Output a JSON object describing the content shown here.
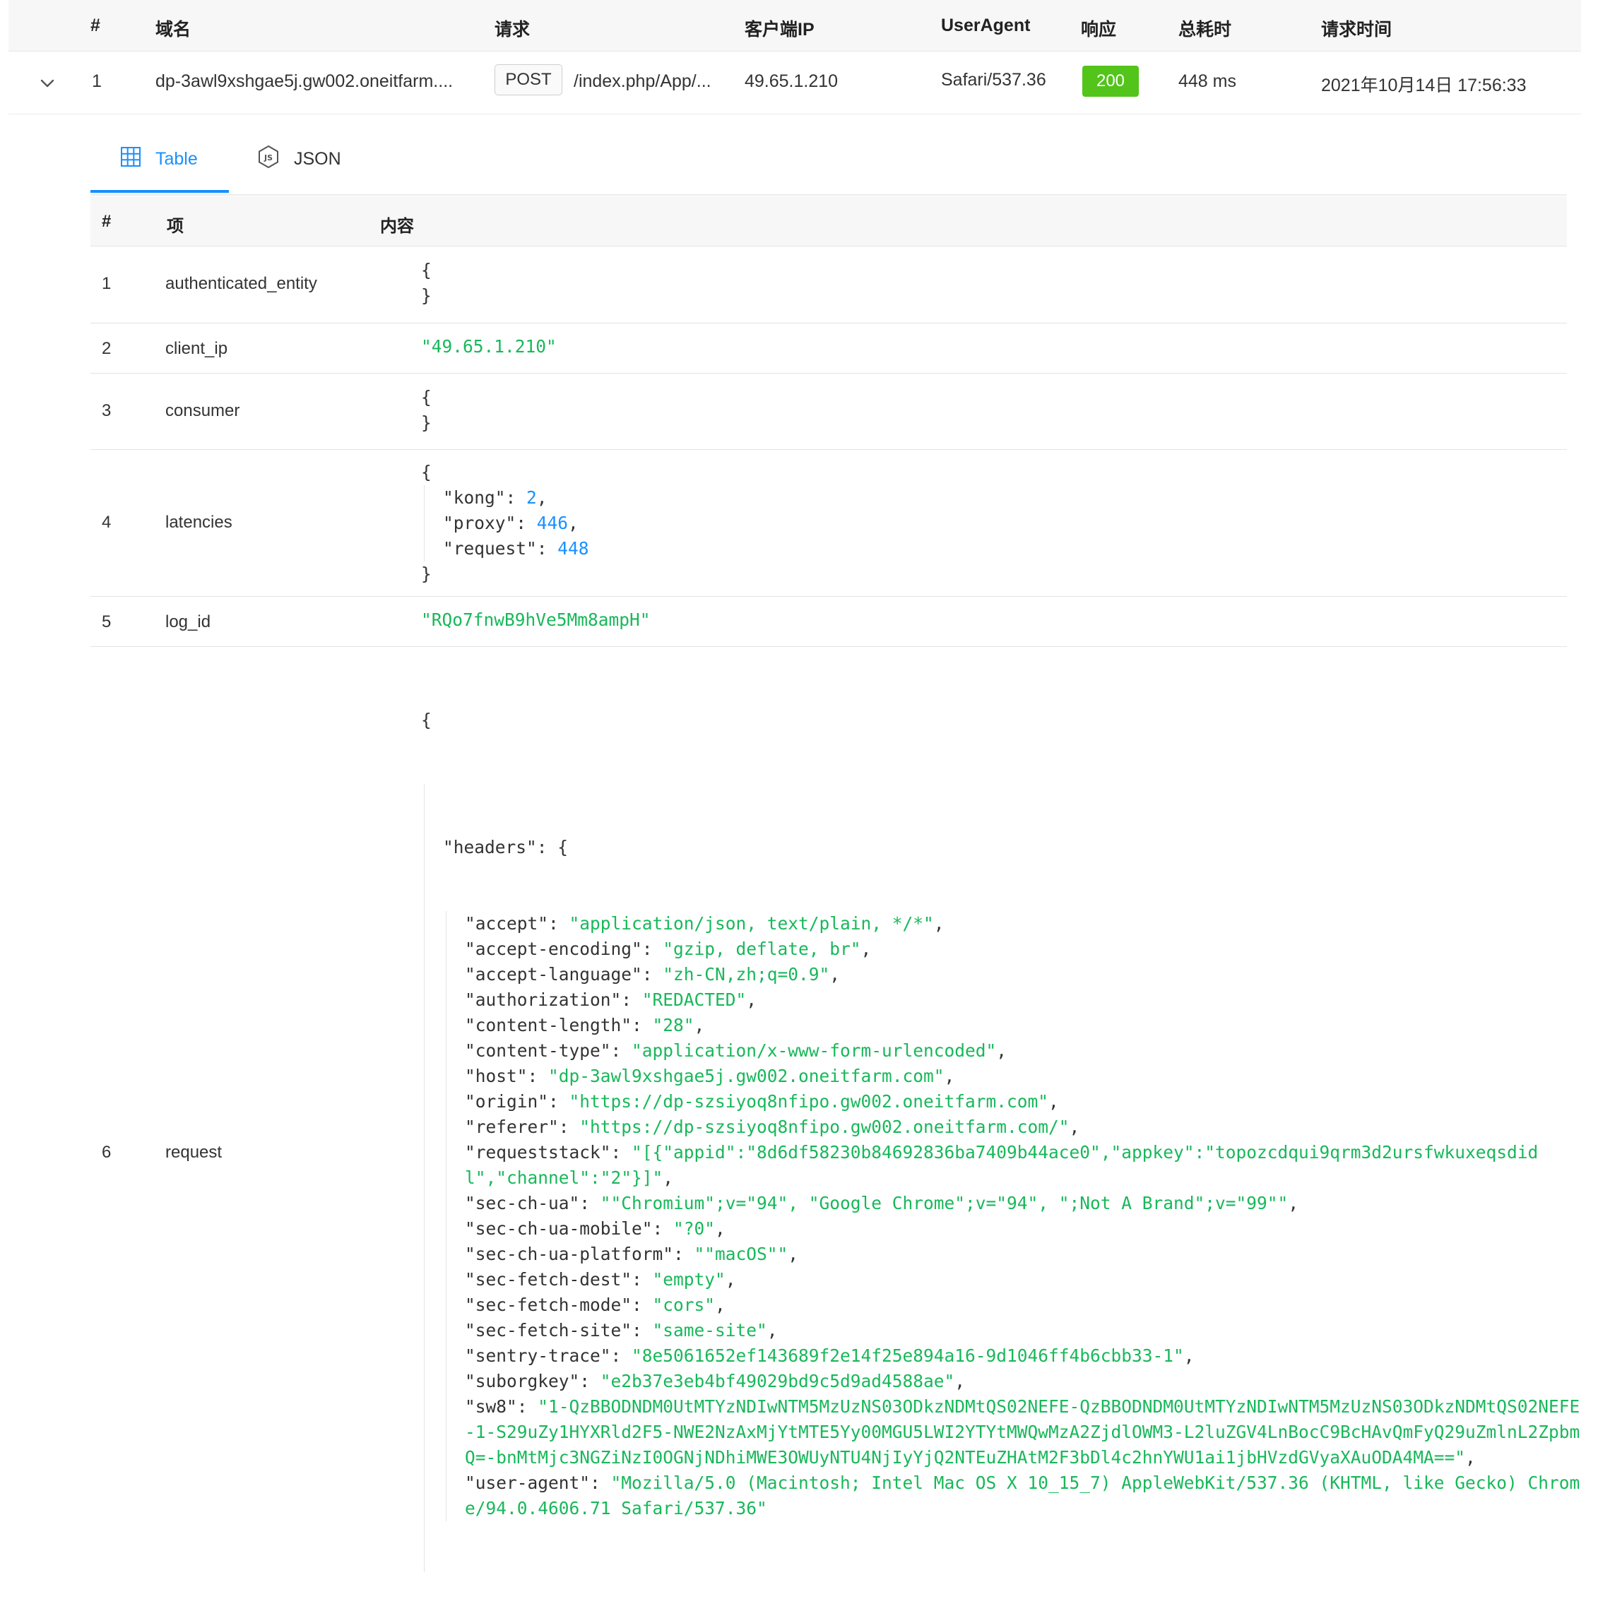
{
  "main_table": {
    "headers": [
      "#",
      "域名",
      "请求",
      "客户端IP",
      "UserAgent",
      "响应",
      "总耗时",
      "请求时间"
    ],
    "row": {
      "index": "1",
      "domain": "dp-3awl9xshgae5j.gw002.oneitfarm....",
      "method": "POST",
      "path": "/index.php/App/...",
      "client_ip": "49.65.1.210",
      "user_agent": "Safari/537.36",
      "status": "200",
      "duration": "448 ms",
      "time": "2021年10月14日 17:56:33"
    }
  },
  "tabs": {
    "table": "Table",
    "json": "JSON",
    "active": "table"
  },
  "detail_table": {
    "headers": [
      "#",
      "项",
      "内容"
    ],
    "rows": [
      {
        "num": "1",
        "key": "authenticated_entity"
      },
      {
        "num": "2",
        "key": "client_ip",
        "value": "\"49.65.1.210\""
      },
      {
        "num": "3",
        "key": "consumer"
      },
      {
        "num": "4",
        "key": "latencies"
      },
      {
        "num": "5",
        "key": "log_id",
        "value": "\"RQo7fnwB9hVe5Mm8ampH\""
      },
      {
        "num": "6",
        "key": "request"
      }
    ]
  },
  "latencies": {
    "kong": "2",
    "proxy": "446",
    "request": "448"
  },
  "request_headers": [
    {
      "k": "\"accept\"",
      "v": "\"application/json, text/plain, */*\""
    },
    {
      "k": "\"accept-encoding\"",
      "v": "\"gzip, deflate, br\""
    },
    {
      "k": "\"accept-language\"",
      "v": "\"zh-CN,zh;q=0.9\""
    },
    {
      "k": "\"authorization\"",
      "v": "\"REDACTED\""
    },
    {
      "k": "\"content-length\"",
      "v": "\"28\""
    },
    {
      "k": "\"content-type\"",
      "v": "\"application/x-www-form-urlencoded\""
    },
    {
      "k": "\"host\"",
      "v": "\"dp-3awl9xshgae5j.gw002.oneitfarm.com\""
    },
    {
      "k": "\"origin\"",
      "v": "\"https://dp-szsiyoq8nfipo.gw002.oneitfarm.com\""
    },
    {
      "k": "\"referer\"",
      "v": "\"https://dp-szsiyoq8nfipo.gw002.oneitfarm.com/\""
    },
    {
      "k": "\"requeststack\"",
      "v": "\"[{\"appid\":\"8d6df58230b84692836ba7409b44ace0\",\"appkey\":\"topozcdqui9qrm3d2ursfwkuxeqsdid",
      "v2": "l\",\"channel\":\"2\"}]\""
    },
    {
      "k": "\"sec-ch-ua\"",
      "v": "\"\"Chromium\";v=\"94\", \"Google Chrome\";v=\"94\", \";Not A Brand\";v=\"99\"\""
    },
    {
      "k": "\"sec-ch-ua-mobile\"",
      "v": "\"?0\""
    },
    {
      "k": "\"sec-ch-ua-platform\"",
      "v": "\"\"macOS\"\""
    },
    {
      "k": "\"sec-fetch-dest\"",
      "v": "\"empty\""
    },
    {
      "k": "\"sec-fetch-mode\"",
      "v": "\"cors\""
    },
    {
      "k": "\"sec-fetch-site\"",
      "v": "\"same-site\""
    },
    {
      "k": "\"sentry-trace\"",
      "v": "\"8e5061652ef143689f2e14f25e894a16-9d1046ff4b6cbb33-1\""
    },
    {
      "k": "\"suborgkey\"",
      "v": "\"e2b37e3eb4bf49029bd9c5d9ad4588ae\""
    },
    {
      "k": "\"sw8\"",
      "v": "\"1-QzBBODNDM0UtMTYzNDIwNTM5MzUzNS03ODkzNDMtQS02NEFE-QzBBODNDM0UtMTYzNDIwNTM5MzUzNS03ODkzNDMtQS02NEFE",
      "v2": "-1-S29uZy1HYXRld2F5-NWE2NzAxMjYtMTE5Yy00MGU5LWI2YTYtMWQwMzA2ZjdlOWM3-L2luZGV4LnBocC9BcHAvQmFyQ29uZmlnL2Zpbm",
      "v3": "Q=-bnMtMjc3NGZiNzI0OGNjNDhiMWE3OWUyNTU4NjIyYjQ2NTEuZHAtM2F3bDl4c2hnYWU1ai1jbHVzdGVyaXAuODA4MA==\""
    },
    {
      "k": "\"user-agent\"",
      "v": "\"Mozilla/5.0 (Macintosh; Intel Mac OS X 10_15_7) AppleWebKit/537.36 (KHTML, like Gecko) Chrom",
      "v2": "e/94.0.4606.71 Safari/537.36\""
    }
  ],
  "colors": {
    "accent": "#1890ff",
    "success": "#52c41a",
    "string": "#18b85a"
  }
}
